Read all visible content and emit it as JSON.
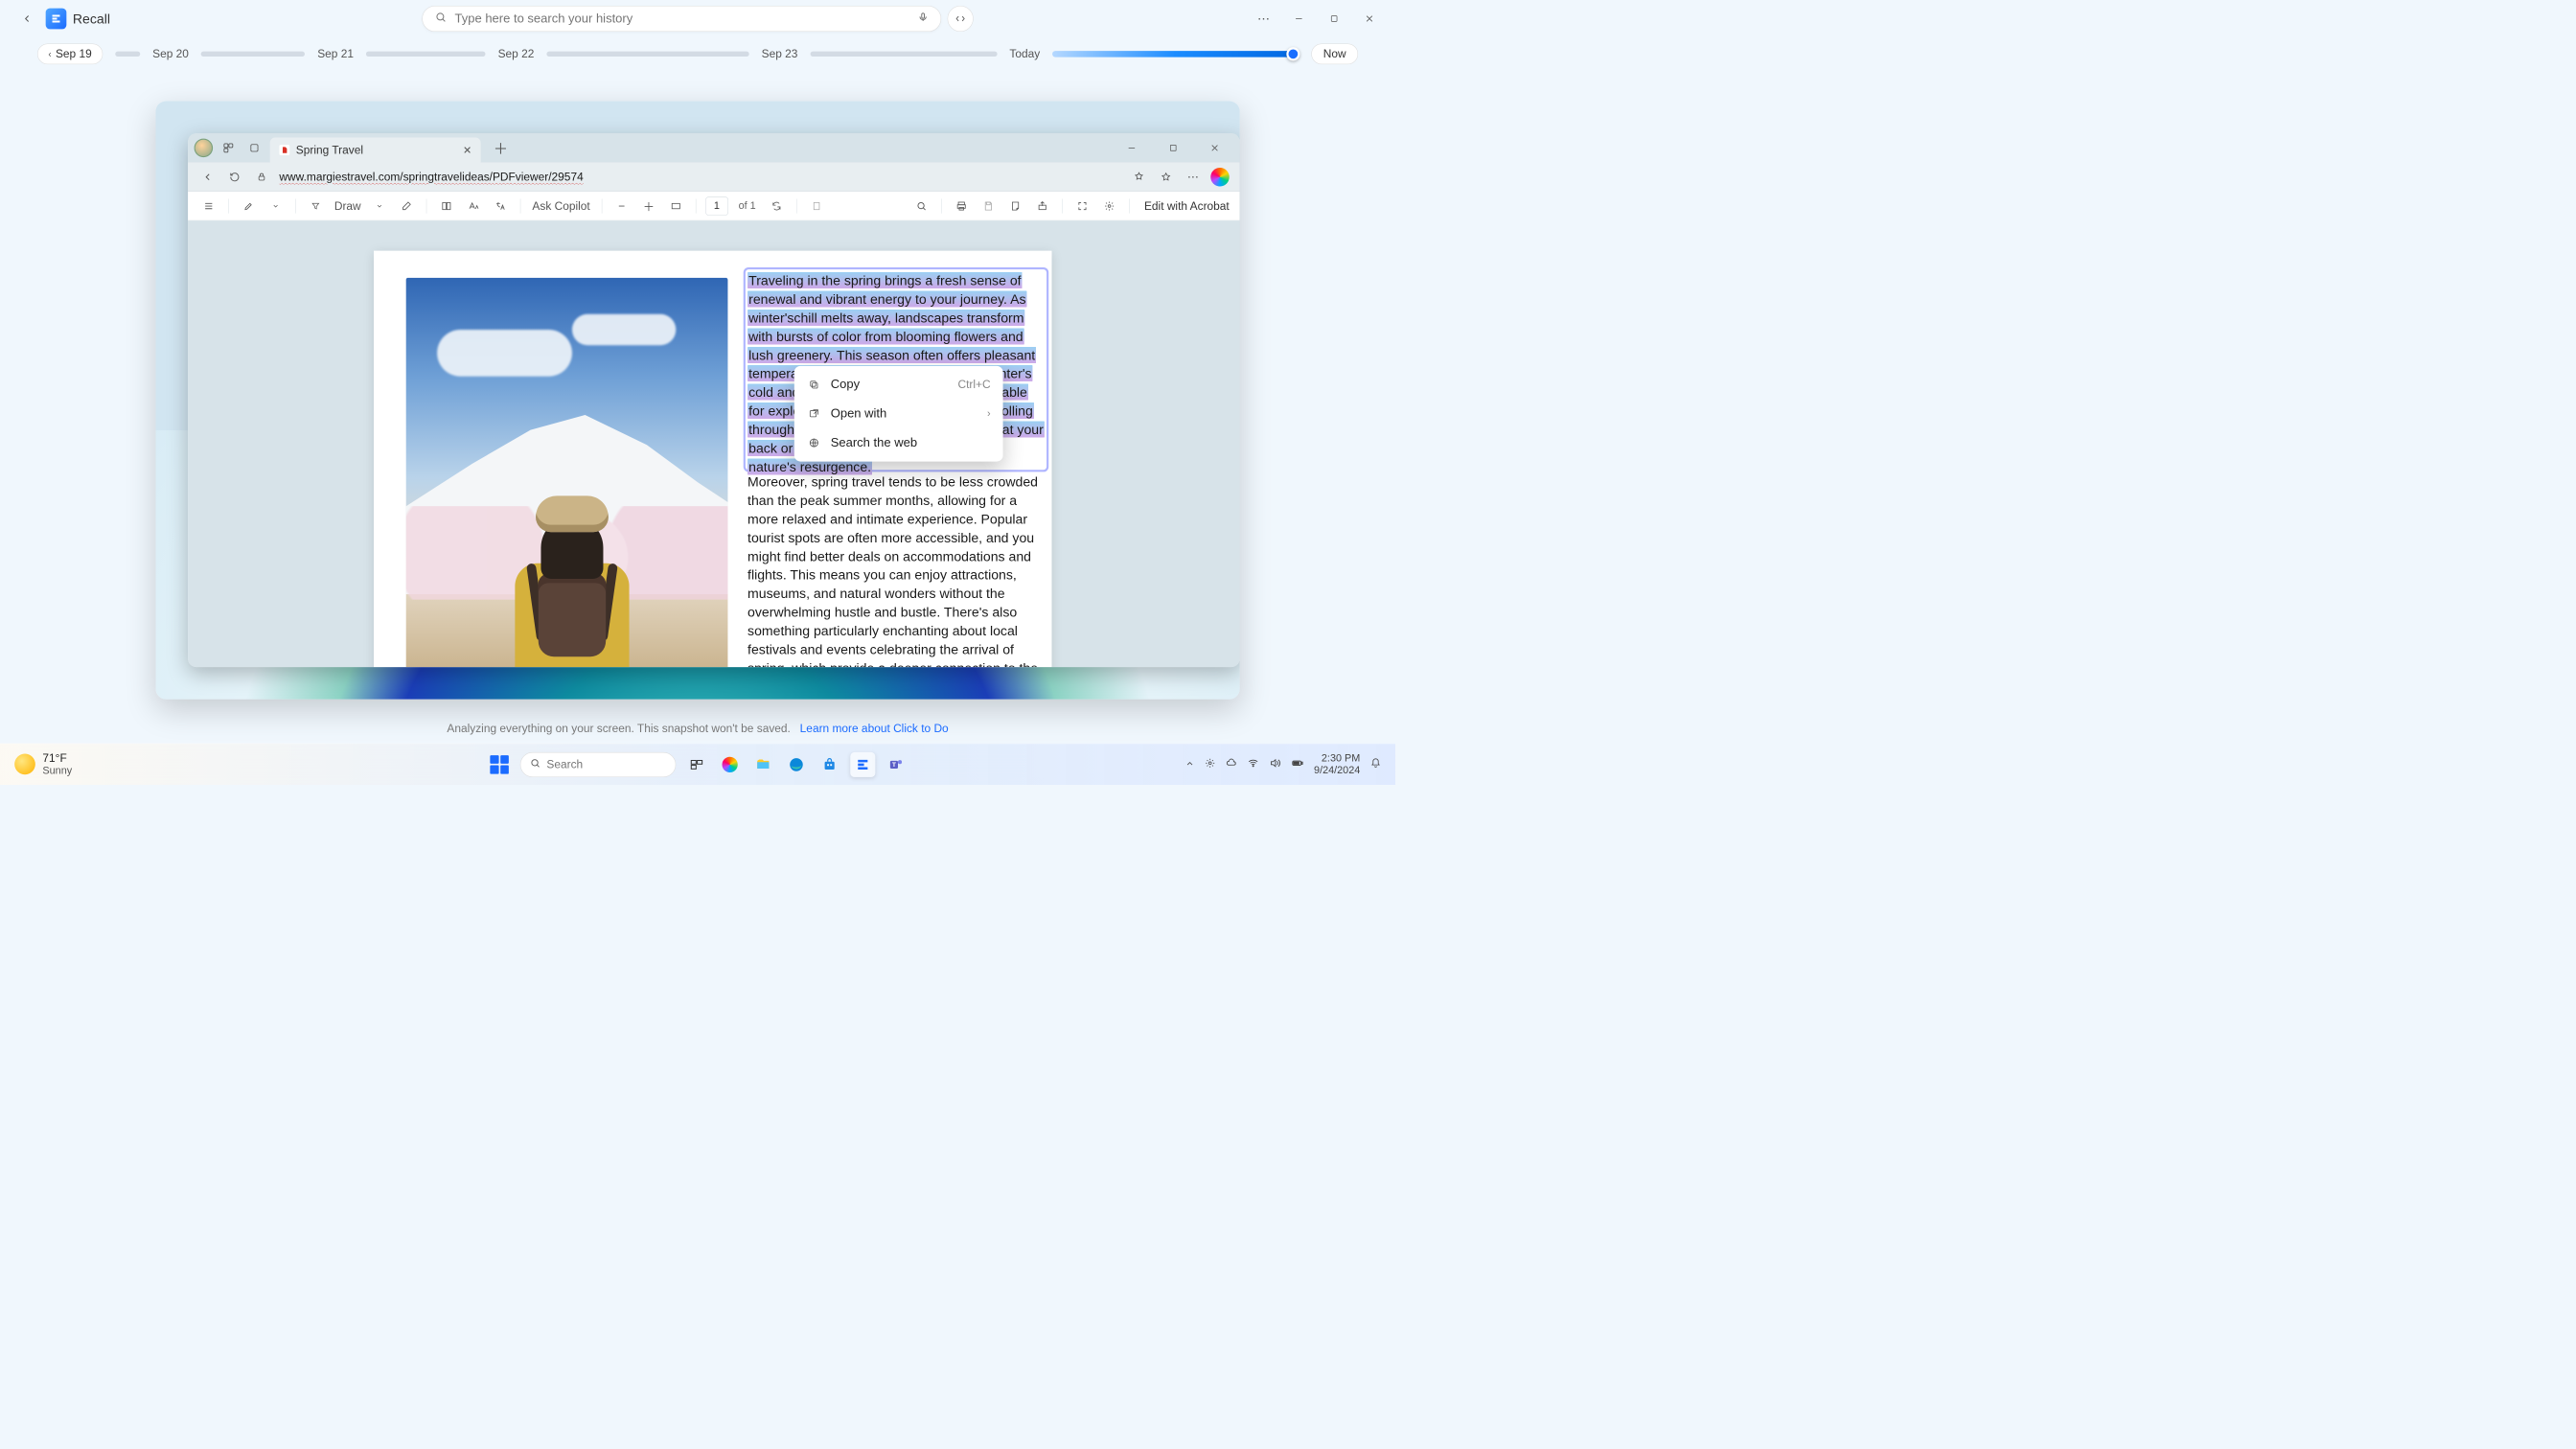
{
  "header": {
    "app_name": "Recall",
    "search_placeholder": "Type here to search your history"
  },
  "timeline": {
    "start_label": "Sep 19",
    "dates": [
      "Sep 20",
      "Sep 21",
      "Sep 22",
      "Sep 23"
    ],
    "today_label": "Today",
    "now_label": "Now"
  },
  "browser": {
    "tab_title": "Spring Travel",
    "url": "www.margiestravel.com/springtravelideas/PDFviewer/29574"
  },
  "pdfbar": {
    "draw_label": "Draw",
    "ask_copilot": "Ask Copilot",
    "page_current": "1",
    "page_total": "of 1",
    "edit_acrobat": "Edit with Acrobat"
  },
  "document": {
    "highlighted_paragraph": "Traveling in the spring brings a fresh sense of renewal and vibrant energy to your journey. As winter'schill melts away, landscapes transform with bursts of color from blooming flowers and lush greenery. This season often offers pleasant temperatures, avoiding the extremes of winter's cold and summer's heat, making it comfortable for exploring new destinations. Imagine strolling through quaint towns with a gentle breeze at your back or hiking scenic trails surrounded by nature's resurgence.",
    "second_paragraph": "Moreover, spring travel tends to be less crowded than the peak summer months, allowing for a more relaxed and intimate experience. Popular tourist spots are often more accessible, and you might find better deals on accommodations and flights. This means you can enjoy attractions, museums, and natural wonders without the overwhelming hustle and bustle. There's also something particularly enchanting about local festivals and events celebrating the arrival of spring, which provide a deeper connection to the culture and traditions of the place you're visiting."
  },
  "context_menu": {
    "copy": "Copy",
    "copy_shortcut": "Ctrl+C",
    "open_with": "Open with",
    "search_web": "Search the web"
  },
  "footer": {
    "note": "Analyzing everything on your screen. This snapshot won't be saved.",
    "link": "Learn more about Click to Do"
  },
  "taskbar": {
    "temp": "71°F",
    "cond": "Sunny",
    "search_placeholder": "Search",
    "time": "2:30 PM",
    "date": "9/24/2024"
  }
}
